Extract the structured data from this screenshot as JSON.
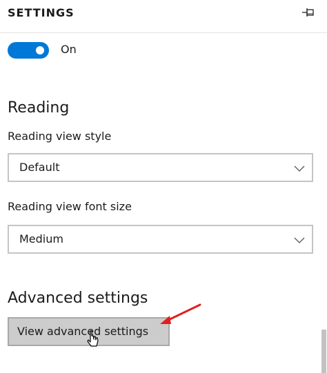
{
  "header": {
    "title": "SETTINGS",
    "pin_icon": "pin-icon"
  },
  "toggle": {
    "state": "on",
    "label": "On",
    "accent_color": "#0078d7"
  },
  "reading": {
    "heading": "Reading",
    "view_style": {
      "label": "Reading view style",
      "value": "Default"
    },
    "font_size": {
      "label": "Reading view font size",
      "value": "Medium"
    }
  },
  "advanced": {
    "heading": "Advanced settings",
    "button_label": "View advanced settings"
  },
  "annotation": {
    "arrow_color": "#e02020"
  }
}
